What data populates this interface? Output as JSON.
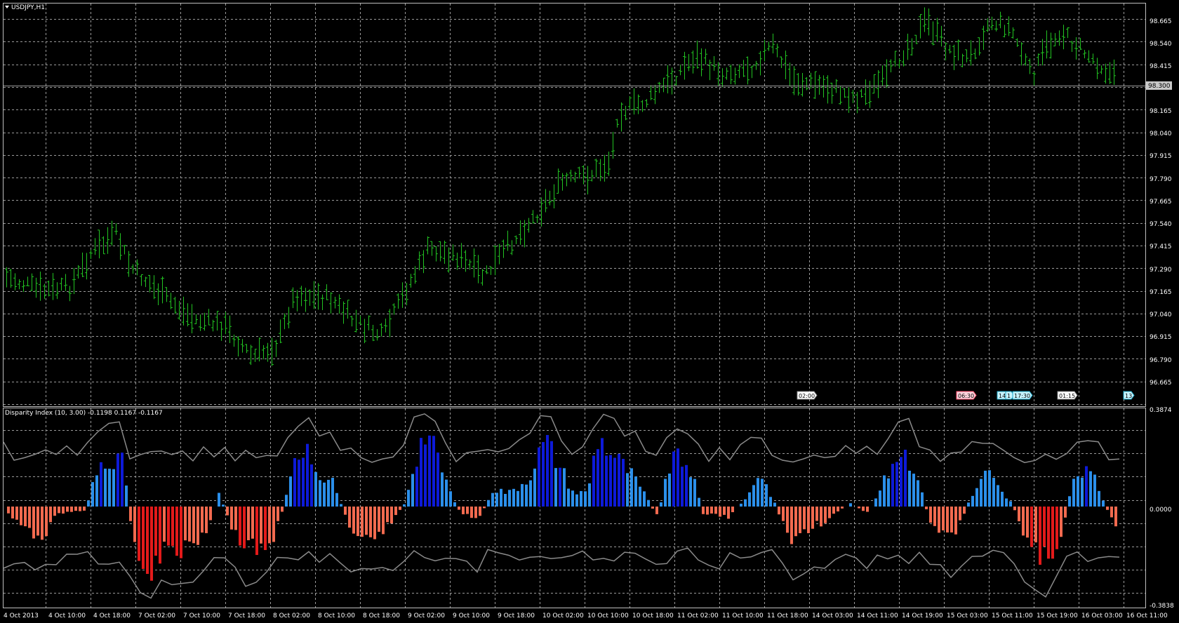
{
  "window": {
    "symbol_label": "USDJPY,H1",
    "menu_icon": "triangle-down-icon"
  },
  "colors": {
    "background": "#000000",
    "grid": "#9a9a9a",
    "price_bar": "#22c322",
    "bid_line": "#9a9a9a",
    "band_line": "#8a8a8a",
    "hist_pos_strong": "#0d1ad8",
    "hist_pos_weak": "#2b8fea",
    "hist_neg_strong": "#e31a1a",
    "hist_neg_weak": "#f26a4f",
    "text": "#ffffff"
  },
  "price_axis": {
    "ticks": [
      "98.665",
      "98.540",
      "98.415",
      "98.300",
      "98.165",
      "98.040",
      "97.915",
      "97.790",
      "97.665",
      "97.540",
      "97.415",
      "97.290",
      "97.165",
      "97.040",
      "96.915",
      "96.790",
      "96.665"
    ],
    "current_price": "98.300"
  },
  "indicator": {
    "title": "Disparity Index (10, 3.00) -0.1198 0.1167 -0.1167",
    "axis_max": "0.3874",
    "axis_zero": "0.0000",
    "axis_min": "-0.3838"
  },
  "time_axis": {
    "labels": [
      "4 Oct 2013",
      "4 Oct 10:00",
      "4 Oct 18:00",
      "7 Oct 02:00",
      "7 Oct 10:00",
      "7 Oct 18:00",
      "8 Oct 02:00",
      "8 Oct 10:00",
      "8 Oct 18:00",
      "9 Oct 02:00",
      "9 Oct 10:00",
      "9 Oct 18:00",
      "10 Oct 02:00",
      "10 Oct 10:00",
      "10 Oct 18:00",
      "11 Oct 02:00",
      "11 Oct 10:00",
      "11 Oct 18:00",
      "14 Oct 03:00",
      "14 Oct 11:00",
      "14 Oct 19:00",
      "15 Oct 03:00",
      "15 Oct 11:00",
      "15 Oct 19:00",
      "16 Oct 03:00",
      "16 Oct 11:00"
    ]
  },
  "event_flags": [
    {
      "label": "02:00",
      "style": "white"
    },
    {
      "label": "06:30",
      "style": "pink"
    },
    {
      "label": "14:",
      "style": "cyan"
    },
    {
      "label": "1",
      "style": "cyan"
    },
    {
      "label": "17:30",
      "style": "cyan"
    },
    {
      "label": "01:15",
      "style": "white"
    },
    {
      "label": "13",
      "style": "cyan"
    }
  ],
  "chart_data": {
    "type": "bar",
    "symbol": "USDJPY",
    "timeframe": "H1",
    "price_ylim": [
      96.6,
      98.72
    ],
    "price_bars": {
      "note_unused": null
    },
    "indicator_ylim": [
      -0.3838,
      0.3874
    ]
  }
}
